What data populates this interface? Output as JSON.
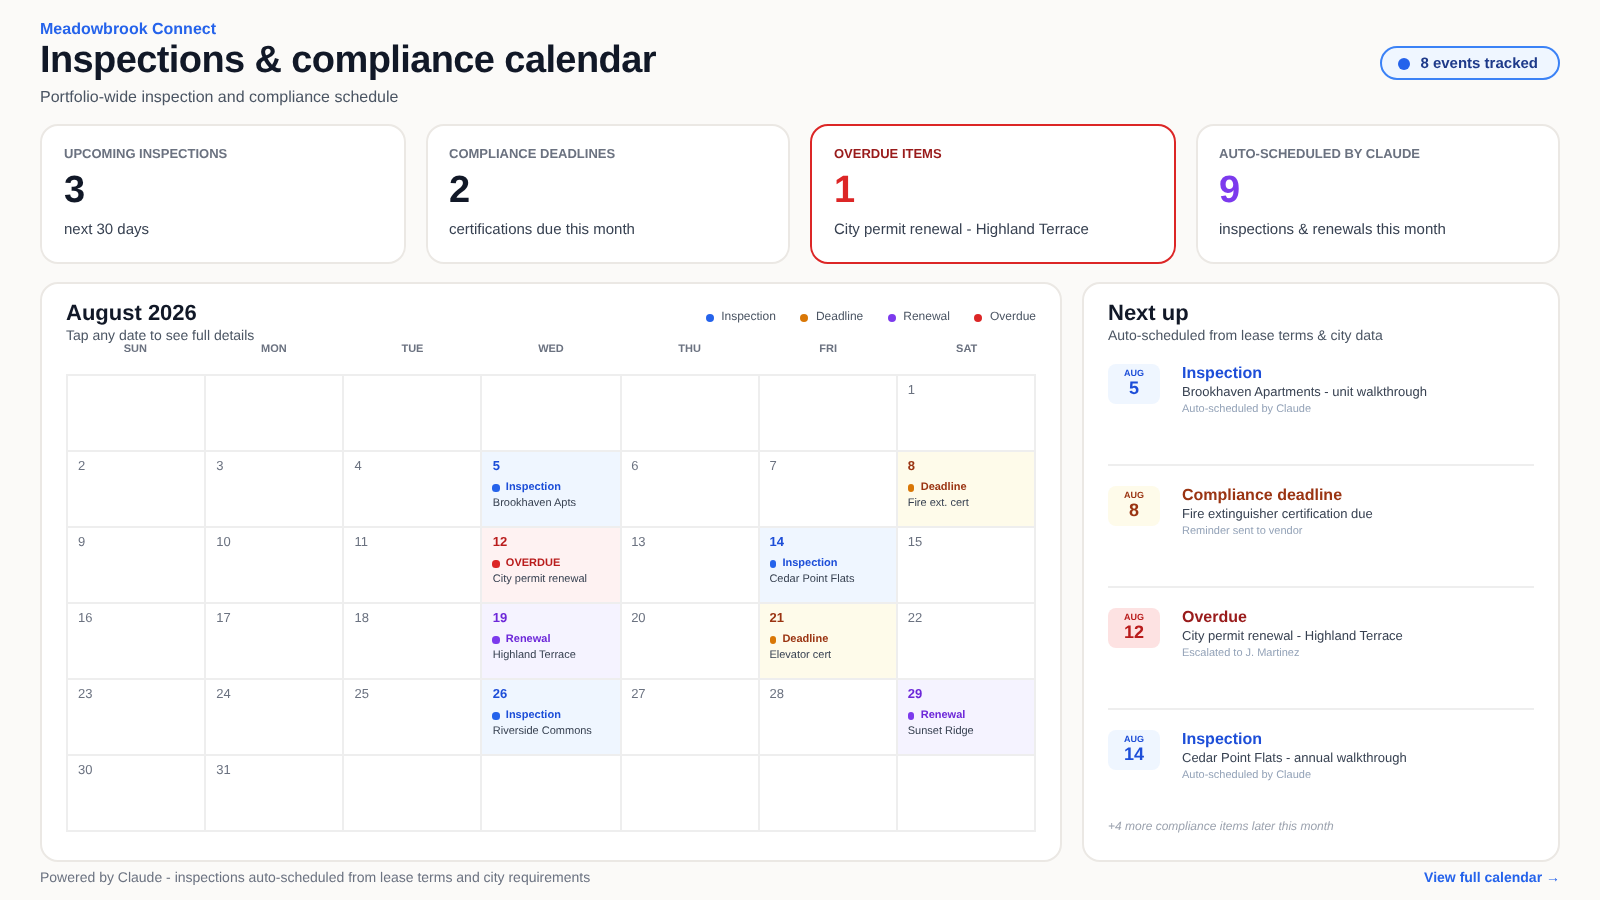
{
  "header": {
    "brand": "Meadowbrook Connect",
    "title": "Inspections & compliance calendar",
    "subtitle": "Portfolio-wide inspection and compliance schedule",
    "badge": "8 events tracked"
  },
  "stats": [
    {
      "label": "UPCOMING INSPECTIONS",
      "value": "3",
      "note": "next 30 days",
      "kind": "default"
    },
    {
      "label": "COMPLIANCE DEADLINES",
      "value": "2",
      "note": "certifications due this month",
      "kind": "default"
    },
    {
      "label": "OVERDUE ITEMS",
      "value": "1",
      "note": "City permit renewal - Highland Terrace",
      "kind": "alert"
    },
    {
      "label": "AUTO-SCHEDULED BY CLAUDE",
      "value": "9",
      "note": "inspections & renewals this month",
      "kind": "auto"
    }
  ],
  "calendar": {
    "title": "August 2026",
    "subtitle": "Tap any date to see full details",
    "legend": [
      {
        "label": "Inspection",
        "color": "#2563eb"
      },
      {
        "label": "Deadline",
        "color": "#d97706"
      },
      {
        "label": "Renewal",
        "color": "#7c3aed"
      },
      {
        "label": "Overdue",
        "color": "#dc2626"
      }
    ],
    "weekdays": [
      "SUN",
      "MON",
      "TUE",
      "WED",
      "THU",
      "FRI",
      "SAT"
    ],
    "weeks": [
      {
        "kind": "first",
        "days": [
          {
            "day": "1"
          }
        ]
      },
      {
        "kind": "full",
        "days": [
          {
            "day": "2"
          },
          {
            "day": "3"
          },
          {
            "day": "4"
          },
          {
            "day": "5",
            "event": {
              "kind": "inspection",
              "label": "Inspection",
              "place": "Brookhaven Apts"
            }
          },
          {
            "day": "6"
          },
          {
            "day": "7"
          },
          {
            "day": "8",
            "event": {
              "kind": "deadline",
              "label": "Deadline",
              "place": "Fire ext. cert"
            }
          }
        ]
      },
      {
        "kind": "full",
        "days": [
          {
            "day": "9"
          },
          {
            "day": "10"
          },
          {
            "day": "11"
          },
          {
            "day": "12",
            "event": {
              "kind": "overdue",
              "label": "OVERDUE",
              "place": "City permit renewal"
            }
          },
          {
            "day": "13"
          },
          {
            "day": "14",
            "event": {
              "kind": "inspection",
              "label": "Inspection",
              "place": "Cedar Point Flats"
            }
          },
          {
            "day": "15"
          }
        ]
      },
      {
        "kind": "full",
        "days": [
          {
            "day": "16"
          },
          {
            "day": "17"
          },
          {
            "day": "18"
          },
          {
            "day": "19",
            "event": {
              "kind": "renewal",
              "label": "Renewal",
              "place": "Highland Terrace"
            }
          },
          {
            "day": "20"
          },
          {
            "day": "21",
            "event": {
              "kind": "deadline",
              "label": "Deadline",
              "place": "Elevator cert"
            }
          },
          {
            "day": "22"
          }
        ]
      },
      {
        "kind": "full",
        "days": [
          {
            "day": "23"
          },
          {
            "day": "24"
          },
          {
            "day": "25"
          },
          {
            "day": "26",
            "event": {
              "kind": "inspection",
              "label": "Inspection",
              "place": "Riverside Commons"
            }
          },
          {
            "day": "27"
          },
          {
            "day": "28"
          },
          {
            "day": "29",
            "event": {
              "kind": "renewal",
              "label": "Renewal",
              "place": "Sunset Ridge"
            }
          }
        ]
      },
      {
        "kind": "last",
        "days": [
          {
            "day": "30"
          },
          {
            "day": "31"
          }
        ]
      }
    ]
  },
  "next_up": {
    "title": "Next up",
    "subtitle": "Auto-scheduled from lease terms & city data",
    "items": [
      {
        "kind": "inspection",
        "month": "AUG",
        "day": "5",
        "title": "Inspection",
        "detail": "Brookhaven Apartments - unit walkthrough",
        "note": "Auto-scheduled by Claude"
      },
      {
        "kind": "deadline",
        "month": "AUG",
        "day": "8",
        "title": "Compliance deadline",
        "detail": "Fire extinguisher certification due",
        "note": "Reminder sent to vendor"
      },
      {
        "kind": "overdue",
        "month": "AUG",
        "day": "12",
        "title": "Overdue",
        "detail": "City permit renewal - Highland Terrace",
        "note": "Escalated to J. Martinez"
      },
      {
        "kind": "inspection",
        "month": "AUG",
        "day": "14",
        "title": "Inspection",
        "detail": "Cedar Point Flats - annual walkthrough",
        "note": "Auto-scheduled by Claude"
      }
    ],
    "more": "+4 more compliance items later this month"
  },
  "footer": {
    "text": "Powered by Claude - inspections auto-scheduled from lease terms and city requirements",
    "link": "View full calendar →"
  }
}
